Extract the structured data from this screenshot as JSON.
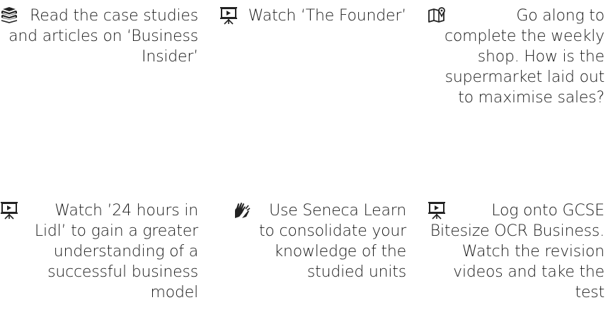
{
  "activities": [
    {
      "icon": "books-icon",
      "text": "Read the case studies and articles on ‘Business Insider’"
    },
    {
      "icon": "presentation-icon",
      "text": "Watch ‘The Founder’"
    },
    {
      "icon": "map-icon",
      "text": "Go along to complete the weekly shop. How is the supermarket laid out to maximise sales?"
    },
    {
      "icon": "presentation-icon",
      "text": "Watch ’24 hours in Lidl’ to gain a greater understanding of a successful business model"
    },
    {
      "icon": "hands-icon",
      "text": "Use Seneca Learn to consolidate your knowledge of the studied units"
    },
    {
      "icon": "presentation-icon",
      "text": "Log onto GCSE Bitesize OCR Business. Watch the revision videos and take the test"
    }
  ]
}
